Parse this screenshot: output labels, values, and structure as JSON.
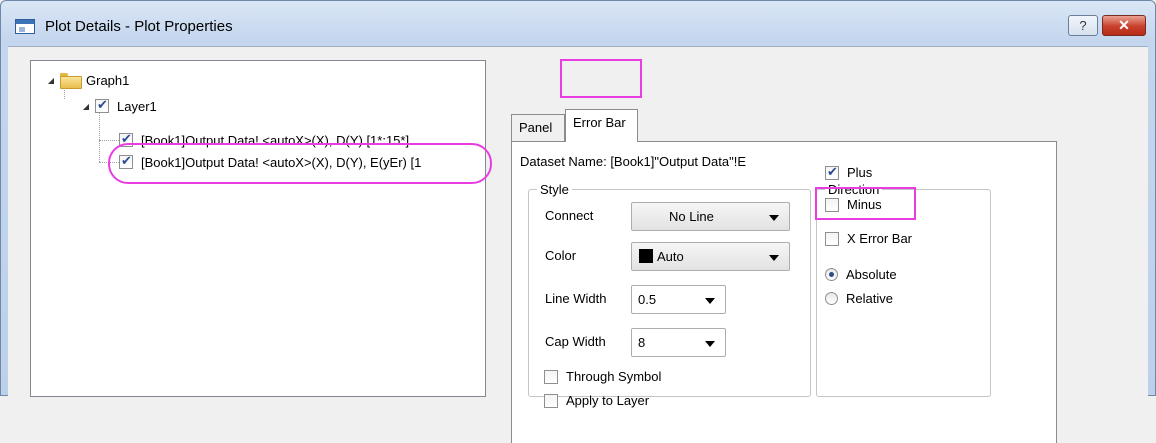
{
  "window": {
    "title": "Plot Details - Plot Properties",
    "help_label": "?",
    "close_label": "✕"
  },
  "tree": {
    "graph": "Graph1",
    "layer": "Layer1",
    "plots": [
      "[Book1]Output Data! <autoX>(X), D(Y) [1*:15*]",
      "[Book1]Output Data! <autoX>(X), D(Y), E(yEr) [1"
    ]
  },
  "tabs": [
    "Panel",
    "Error Bar"
  ],
  "dataset_name": "Dataset Name: [Book1]\"Output Data\"!E",
  "style": {
    "legend": "Style",
    "connect_label": "Connect",
    "connect_value": "No Line",
    "color_label": "Color",
    "color_value": "Auto",
    "line_width_label": "Line Width",
    "line_width_value": "0.5",
    "cap_width_label": "Cap Width",
    "cap_width_value": "8",
    "through_symbol": "Through Symbol",
    "apply_to_layer": "Apply to Layer"
  },
  "direction": {
    "legend": "Direction",
    "plus": "Plus",
    "minus": "Minus",
    "x_error_bar": "X Error Bar",
    "absolute": "Absolute",
    "relative": "Relative"
  },
  "colors": {
    "highlight": "#e83ee0",
    "close_button": "#c8402b",
    "color_swatch": "#000000"
  }
}
